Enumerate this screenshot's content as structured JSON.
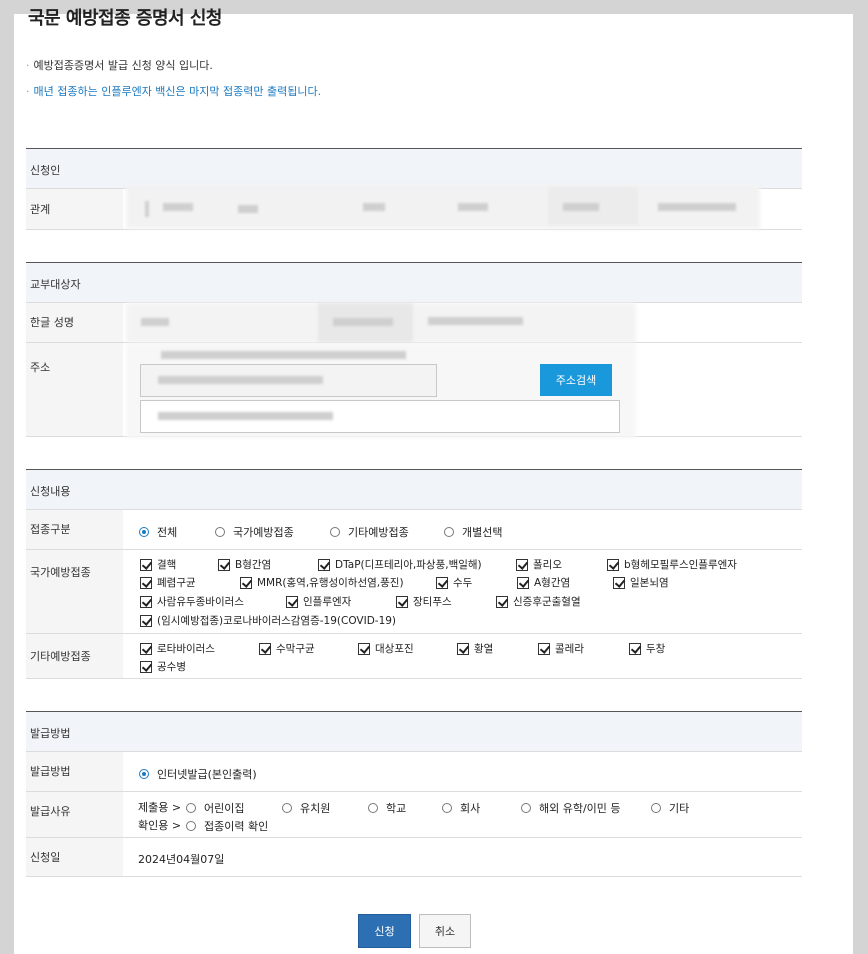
{
  "page": {
    "title": "국문 예방접종 증명서 신청",
    "note1": "예방접종증명서 발급 신청 양식 입니다.",
    "note2": "매년 접종하는 인플루엔자 백신은 마지막 접종력만 출력됩니다."
  },
  "applicant": {
    "section_title": "신청인",
    "relation_label": "관계"
  },
  "recipient": {
    "section_title": "교부대상자",
    "name_label": "한글 성명",
    "address_label": "주소",
    "address_search_button": "주소검색"
  },
  "content": {
    "section_title": "신청내용",
    "type_label": "접종구분",
    "type_options": [
      "전체",
      "국가예방접종",
      "기타예방접종",
      "개별선택"
    ],
    "national_label": "국가예방접종",
    "national_items": [
      "결핵",
      "B형간염",
      "DTaP(디프테리아,파상풍,백일해)",
      "폴리오",
      "b형헤모필루스인플루엔자",
      "폐렴구균",
      "MMR(홍역,유행성이하선염,풍진)",
      "수두",
      "A형간염",
      "일본뇌염",
      "사람유두종바이러스",
      "인플루엔자",
      "장티푸스",
      "신증후군출혈열",
      "(임시예방접종)코로나바이러스감염증-19(COVID-19)"
    ],
    "other_label": "기타예방접종",
    "other_items": [
      "로타바이러스",
      "수막구균",
      "대상포진",
      "황열",
      "콜레라",
      "두창",
      "공수병"
    ]
  },
  "issue": {
    "section_title": "발급방법",
    "method_label": "발급방법",
    "method_option": "인터넷발급(본인출력)",
    "reason_label": "발급사유",
    "submit_prefix": "제출용 >",
    "submit_options": [
      "어린이집",
      "유치원",
      "학교",
      "회사",
      "해외 유학/이민 등",
      "기타"
    ],
    "confirm_prefix": "확인용 >",
    "confirm_option": "접종이력 확인",
    "date_label": "신청일",
    "date_value": "2024년04월07일"
  },
  "buttons": {
    "submit": "신청",
    "cancel": "취소"
  },
  "colors": {
    "accent": "#1a98dc",
    "primary_button": "#2c6fb3",
    "link_blue": "#1a7ac2"
  }
}
